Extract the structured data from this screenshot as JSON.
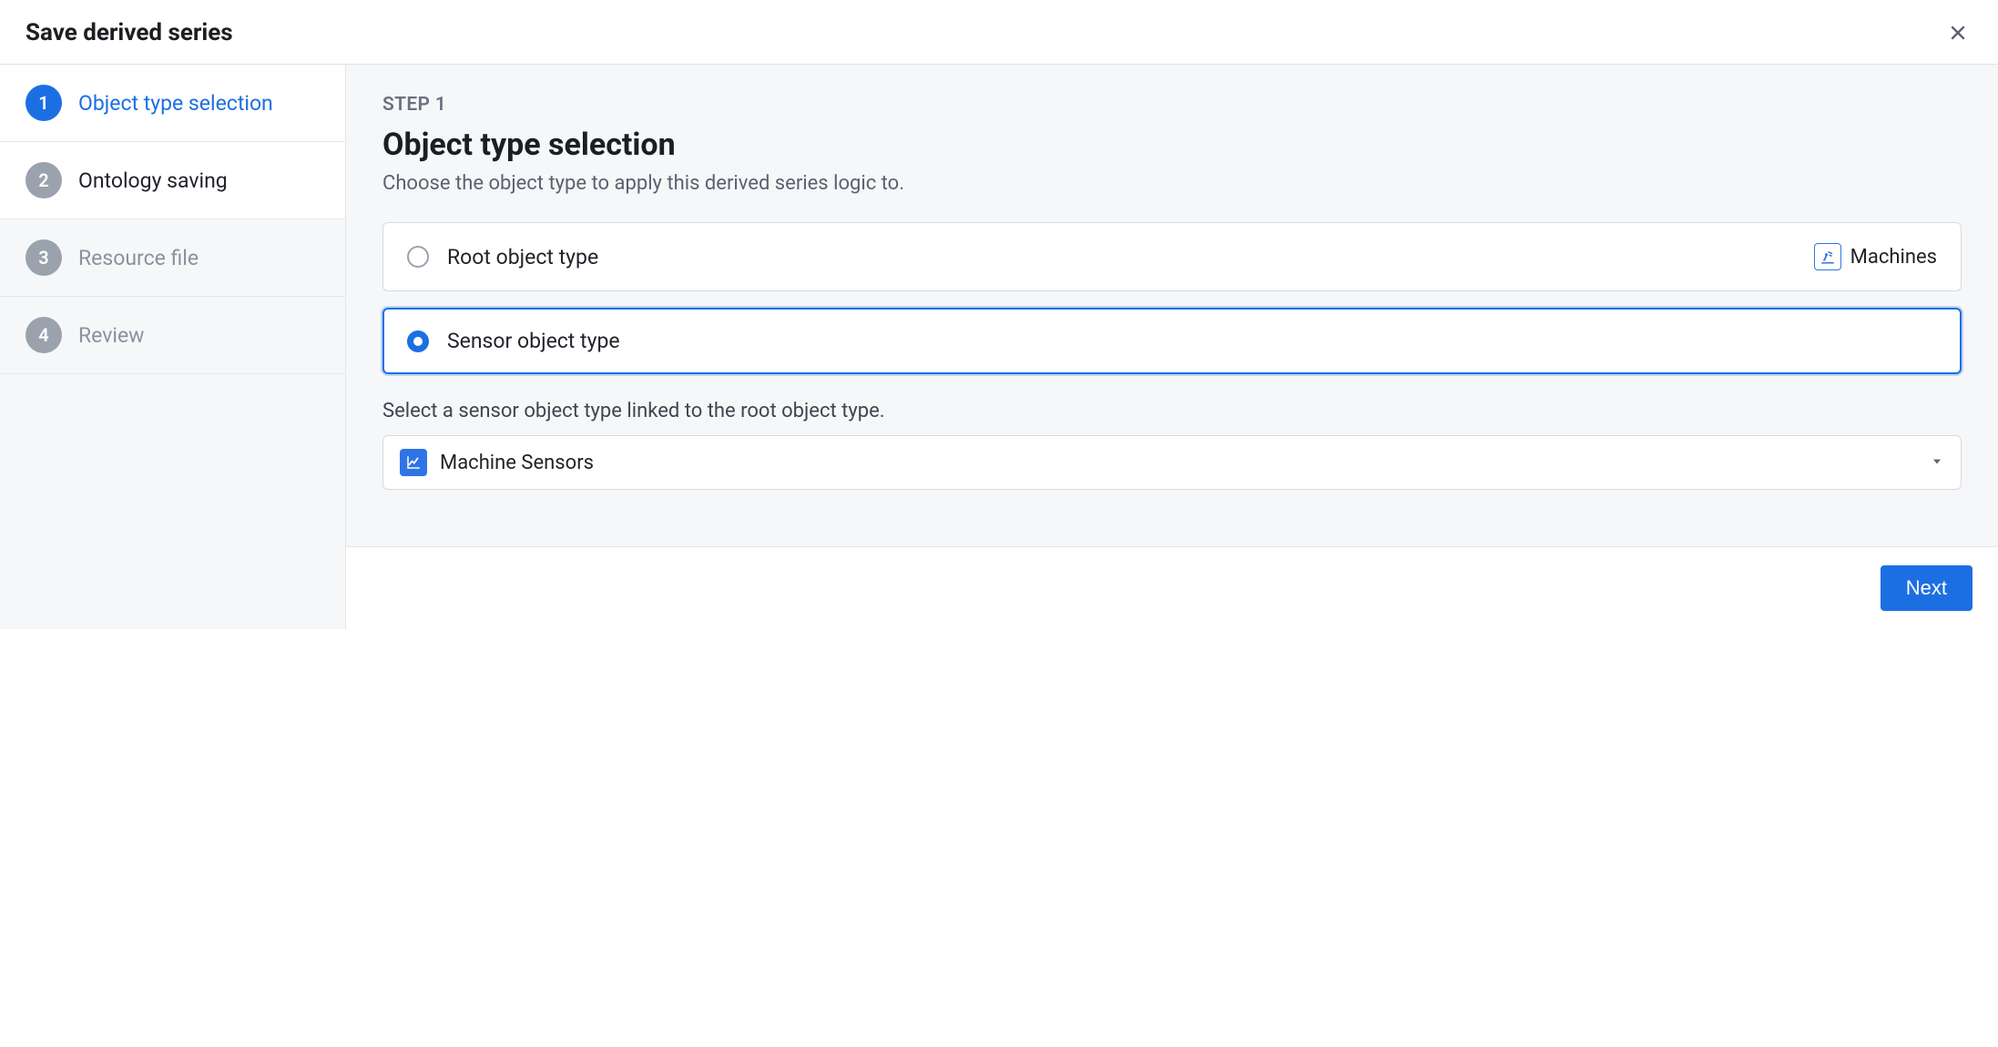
{
  "dialog": {
    "title": "Save derived series"
  },
  "sidebar": {
    "steps": [
      {
        "num": "1",
        "label": "Object type selection"
      },
      {
        "num": "2",
        "label": "Ontology saving"
      },
      {
        "num": "3",
        "label": "Resource file"
      },
      {
        "num": "4",
        "label": "Review"
      }
    ]
  },
  "main": {
    "eyebrow": "STEP 1",
    "heading": "Object type selection",
    "description": "Choose the object type to apply this derived series logic to.",
    "root_option_label": "Root object type",
    "root_option_value": "Machines",
    "sensor_option_label": "Sensor object type",
    "sensor_select_prompt": "Select a sensor object type linked to the root object type.",
    "sensor_select_value": "Machine Sensors"
  },
  "footer": {
    "next_label": "Next"
  },
  "colors": {
    "accent": "#1c6fe3",
    "muted": "#9aa2ad"
  }
}
